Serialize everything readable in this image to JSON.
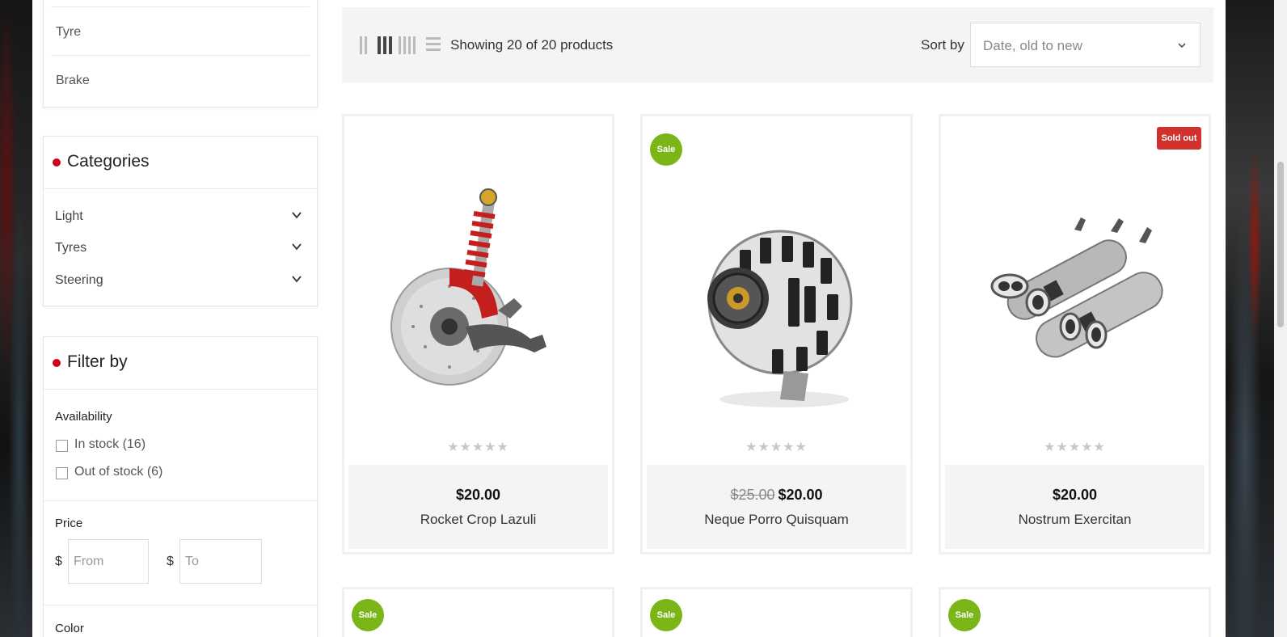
{
  "sidebar": {
    "links": [
      "Tyre",
      "Brake"
    ],
    "categories": {
      "title": "Categories",
      "items": [
        {
          "label": "Light"
        },
        {
          "label": "Tyres"
        },
        {
          "label": "Steering"
        }
      ]
    },
    "filter": {
      "title": "Filter by",
      "availability": {
        "label": "Availability",
        "options": [
          {
            "label": "In stock (16)",
            "checked": false
          },
          {
            "label": "Out of stock (6)",
            "checked": false
          }
        ]
      },
      "price": {
        "label": "Price",
        "currency": "$",
        "from_placeholder": "From",
        "to_placeholder": "To"
      },
      "next_section_label": "Color"
    }
  },
  "toolbar": {
    "view_modes": [
      "2-columns-icon",
      "3-columns-icon",
      "4-columns-icon",
      "list-icon"
    ],
    "active_view": "3-columns-icon",
    "showing_text": "Showing 20 of 20 products",
    "sort_label": "Sort by",
    "sort_value": "Date, old to new"
  },
  "products": [
    {
      "name": "Rocket Crop Lazuli",
      "price": "$20.00",
      "old_price": "",
      "badge": "",
      "rating": "★★★★★",
      "image": "brake-shock-assembly"
    },
    {
      "name": "Neque Porro Quisquam",
      "price": "$20.00",
      "old_price": "$25.00",
      "badge": "Sale",
      "rating": "★★★★★",
      "image": "alternator"
    },
    {
      "name": "Nostrum Exercitan",
      "price": "$20.00",
      "old_price": "",
      "badge": "Sold out",
      "rating": "★★★★★",
      "image": "exhaust-mufflers"
    }
  ],
  "next_row_badges": [
    "Sale",
    "Sale",
    "Sale"
  ],
  "colors": {
    "accent_red": "#d0021b",
    "sale_green": "#7ab617",
    "sold_out_red": "#d0312d",
    "panel_grey": "#f4f4f4"
  }
}
